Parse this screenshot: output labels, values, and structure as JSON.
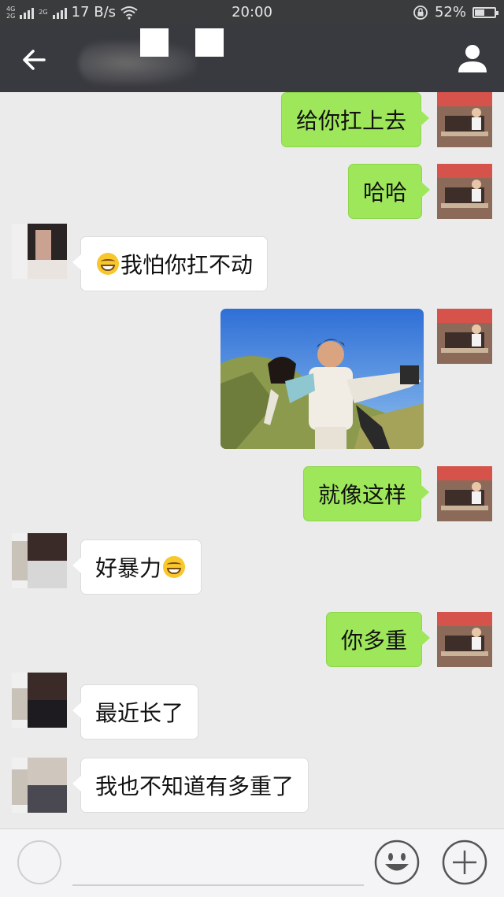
{
  "status_bar": {
    "network_top": "4G",
    "network_bottom": "2G",
    "network_2": "2G",
    "speed": "17 B/s",
    "time": "20:00",
    "battery": "52%",
    "battery_level": 0.52
  },
  "header": {
    "back_icon": "arrow-left-icon",
    "profile_icon": "person-icon"
  },
  "messages": [
    {
      "side": "out",
      "text": "给你扛上去"
    },
    {
      "side": "out",
      "text": "哈哈"
    },
    {
      "side": "in",
      "text": "我怕你扛不动",
      "emoji_before": "grinning-face-icon"
    },
    {
      "side": "out",
      "type": "image",
      "description_icon": "photo"
    },
    {
      "side": "out",
      "text": "就像这样"
    },
    {
      "side": "in",
      "text": "好暴力",
      "emoji_after": "grinning-face-icon"
    },
    {
      "side": "out",
      "text": "你多重"
    },
    {
      "side": "in",
      "text": "最近长了"
    },
    {
      "side": "in",
      "text": "我也不知道有多重了"
    }
  ],
  "input_bar": {
    "voice_icon": "voice-icon",
    "emoji_icon": "smile-icon",
    "plus_icon": "plus-icon"
  },
  "colors": {
    "out_bubble": "#9ee75a",
    "in_bubble": "#ffffff",
    "header": "#393a3f",
    "chat_bg": "#ebebeb"
  }
}
